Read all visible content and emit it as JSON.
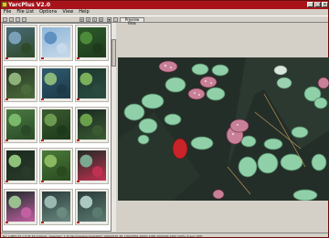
{
  "window": {
    "title": "YarcPlus V2.0"
  },
  "menu": [
    "File",
    "File List",
    "Options",
    "View",
    "Help"
  ],
  "toolbar": {
    "preview_label": "Preview Files",
    "buttons": [
      "open-icon",
      "save-icon",
      "grid-icon",
      "refresh-icon",
      "first-icon",
      "prev-icon",
      "next-icon",
      "last-icon",
      "down-icon",
      "filter-icon"
    ]
  },
  "thumbnails": [
    {
      "palette": [
        "#4a6a78",
        "#7aa0b8",
        "#2f4a28"
      ]
    },
    {
      "palette": [
        "#8fb6d8",
        "#5e90c0",
        "#c7d9ea"
      ]
    },
    {
      "palette": [
        "#2d5a2a",
        "#4d8a3a",
        "#1e3a1c"
      ]
    },
    {
      "palette": [
        "#2a3a28",
        "#8fb27a",
        "#4a6a3a"
      ]
    },
    {
      "palette": [
        "#2e5a6e",
        "#8ab87a",
        "#1e3a48"
      ]
    },
    {
      "palette": [
        "#1e3a30",
        "#7ab05a",
        "#2a4a40"
      ]
    },
    {
      "palette": [
        "#4a7a40",
        "#7ab86a",
        "#2a4a28"
      ]
    },
    {
      "palette": [
        "#3a5a30",
        "#6a9a50",
        "#1e3a1a"
      ]
    },
    {
      "palette": [
        "#1a2a22",
        "#6aa04a",
        "#3a5a32"
      ]
    },
    {
      "palette": [
        "#1a2a1e",
        "#8fc07a",
        "#2a3a2a"
      ]
    },
    {
      "palette": [
        "#4a7a38",
        "#8ab860",
        "#2a4a20"
      ]
    },
    {
      "palette": [
        "#1e2a24",
        "#7aa890",
        "#c03050"
      ]
    },
    {
      "palette": [
        "#1e2a2a",
        "#9ac090",
        "#c060a0"
      ]
    },
    {
      "palette": [
        "#2a3a3a",
        "#9ab8b0",
        "#6a8a80"
      ]
    },
    {
      "palette": [
        "#2a3a3a",
        "#aac8c0",
        "#5a7a70"
      ]
    }
  ],
  "status": "No: s:JPEG 97 x 8 95 49 Outlook : Selected : 1 D:\\Yarcimage\\vc\\Aqa\\0017_20010530_P9_1000.JPEG 1000x 1066 1000x66 1000 100% (0 sec) UMT",
  "colors": {
    "titlebar": "#a8131a",
    "chrome": "#d4d0c8"
  }
}
